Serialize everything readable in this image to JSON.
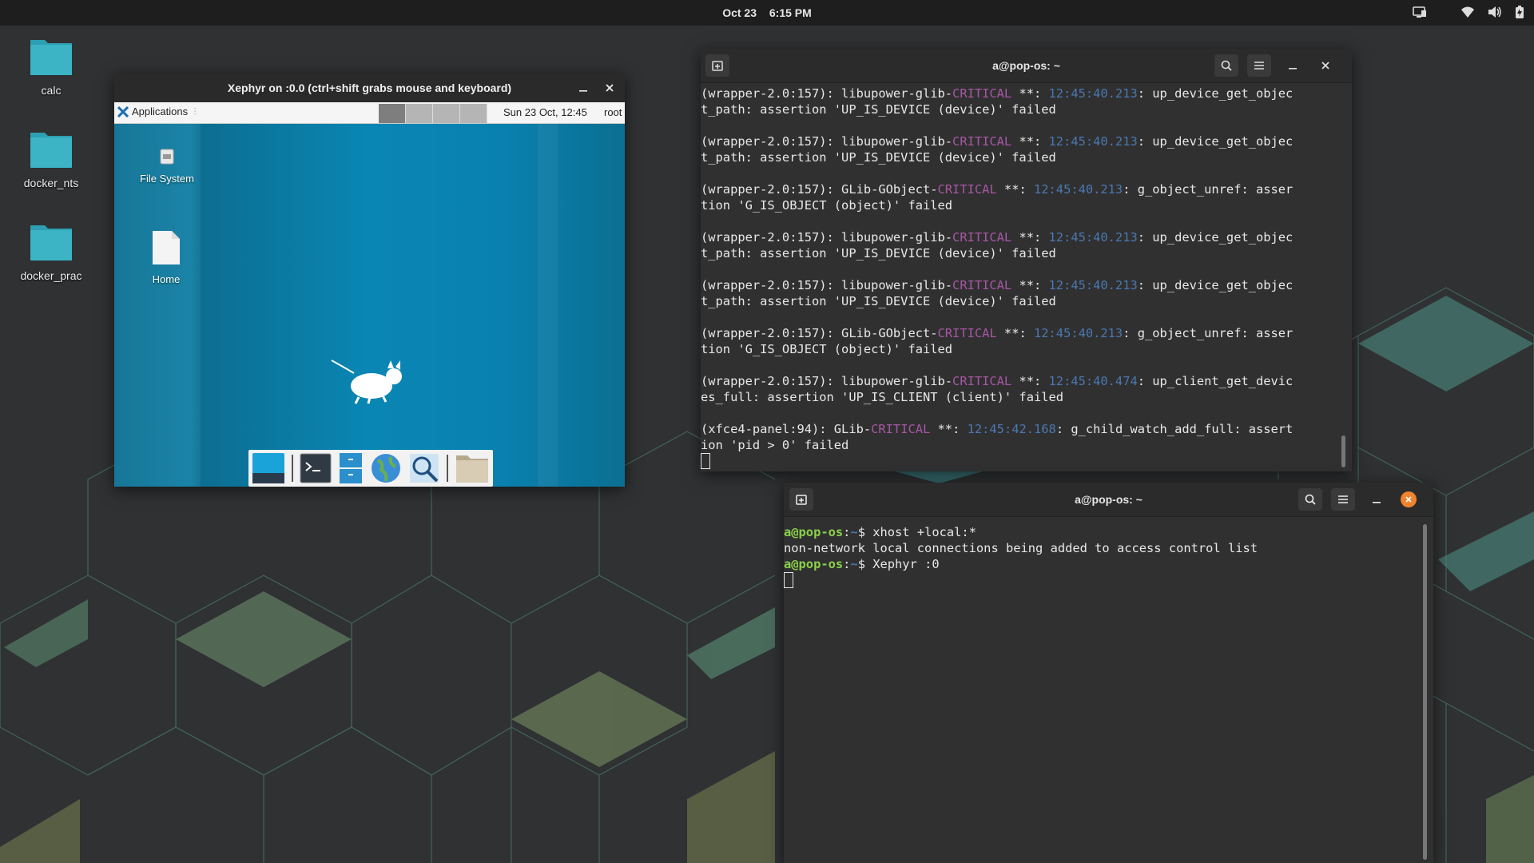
{
  "topbar": {
    "date": "Oct 23",
    "time": "6:15 PM",
    "tray_icons": [
      "display-icon",
      "wifi-icon",
      "volume-icon",
      "battery-icon"
    ]
  },
  "desktop_icons": [
    {
      "label": "calc",
      "icon": "folder-icon"
    },
    {
      "label": "docker_nts",
      "icon": "folder-icon"
    },
    {
      "label": "docker_prac",
      "icon": "folder-icon"
    }
  ],
  "xephyr": {
    "title": "Xephyr on :0.0 (ctrl+shift grabs mouse and keyboard)",
    "panel": {
      "applications": "Applications",
      "date": "Sun 23 Oct, 12:45",
      "user": "root"
    },
    "desktop_icons": [
      {
        "label": "File System",
        "icon": "drive-icon"
      },
      {
        "label": "Home",
        "icon": "home-file-icon"
      }
    ],
    "dock_items": [
      "show-desktop-icon",
      "terminal-icon",
      "file-manager-icon",
      "web-browser-icon",
      "app-finder-icon",
      "folder-icon"
    ]
  },
  "terminal1": {
    "title": "a@pop-os: ~",
    "lines": [
      [
        {
          "t": "(wrapper-2.0:157): libupower-glib-"
        },
        {
          "t": "CRITICAL",
          "c": "crit"
        },
        {
          "t": " **: "
        },
        {
          "t": "12:45:40.213",
          "c": "ts"
        },
        {
          "t": ": up_device_get_objec"
        }
      ],
      [
        {
          "t": "t_path: assertion 'UP_IS_DEVICE (device)' failed"
        }
      ],
      [
        {
          "t": ""
        }
      ],
      [
        {
          "t": "(wrapper-2.0:157): libupower-glib-"
        },
        {
          "t": "CRITICAL",
          "c": "crit"
        },
        {
          "t": " **: "
        },
        {
          "t": "12:45:40.213",
          "c": "ts"
        },
        {
          "t": ": up_device_get_objec"
        }
      ],
      [
        {
          "t": "t_path: assertion 'UP_IS_DEVICE (device)' failed"
        }
      ],
      [
        {
          "t": ""
        }
      ],
      [
        {
          "t": "(wrapper-2.0:157): GLib-GObject-"
        },
        {
          "t": "CRITICAL",
          "c": "crit"
        },
        {
          "t": " **: "
        },
        {
          "t": "12:45:40.213",
          "c": "ts"
        },
        {
          "t": ": g_object_unref: asser"
        }
      ],
      [
        {
          "t": "tion 'G_IS_OBJECT (object)' failed"
        }
      ],
      [
        {
          "t": ""
        }
      ],
      [
        {
          "t": "(wrapper-2.0:157): libupower-glib-"
        },
        {
          "t": "CRITICAL",
          "c": "crit"
        },
        {
          "t": " **: "
        },
        {
          "t": "12:45:40.213",
          "c": "ts"
        },
        {
          "t": ": up_device_get_objec"
        }
      ],
      [
        {
          "t": "t_path: assertion 'UP_IS_DEVICE (device)' failed"
        }
      ],
      [
        {
          "t": ""
        }
      ],
      [
        {
          "t": "(wrapper-2.0:157): libupower-glib-"
        },
        {
          "t": "CRITICAL",
          "c": "crit"
        },
        {
          "t": " **: "
        },
        {
          "t": "12:45:40.213",
          "c": "ts"
        },
        {
          "t": ": up_device_get_objec"
        }
      ],
      [
        {
          "t": "t_path: assertion 'UP_IS_DEVICE (device)' failed"
        }
      ],
      [
        {
          "t": ""
        }
      ],
      [
        {
          "t": "(wrapper-2.0:157): GLib-GObject-"
        },
        {
          "t": "CRITICAL",
          "c": "crit"
        },
        {
          "t": " **: "
        },
        {
          "t": "12:45:40.213",
          "c": "ts"
        },
        {
          "t": ": g_object_unref: asser"
        }
      ],
      [
        {
          "t": "tion 'G_IS_OBJECT (object)' failed"
        }
      ],
      [
        {
          "t": ""
        }
      ],
      [
        {
          "t": "(wrapper-2.0:157): libupower-glib-"
        },
        {
          "t": "CRITICAL",
          "c": "crit"
        },
        {
          "t": " **: "
        },
        {
          "t": "12:45:40.474",
          "c": "ts"
        },
        {
          "t": ": up_client_get_devic"
        }
      ],
      [
        {
          "t": "es_full: assertion 'UP_IS_CLIENT (client)' failed"
        }
      ],
      [
        {
          "t": ""
        }
      ],
      [
        {
          "t": "(xfce4-panel:94): GLib-"
        },
        {
          "t": "CRITICAL",
          "c": "crit"
        },
        {
          "t": " **: "
        },
        {
          "t": "12:45:42.168",
          "c": "ts"
        },
        {
          "t": ": g_child_watch_add_full: assert"
        }
      ],
      [
        {
          "t": "ion 'pid > 0' failed"
        }
      ]
    ]
  },
  "terminal2": {
    "title": "a@pop-os: ~",
    "lines": [
      [
        {
          "t": "a@pop-os",
          "c": "prompt-user"
        },
        {
          "t": ":"
        },
        {
          "t": "~",
          "c": "prompt-path"
        },
        {
          "t": "$ xhost +local:*"
        }
      ],
      [
        {
          "t": "non-network local connections being added to access control list"
        }
      ],
      [
        {
          "t": "a@pop-os",
          "c": "prompt-user"
        },
        {
          "t": ":"
        },
        {
          "t": "~",
          "c": "prompt-path"
        },
        {
          "t": "$ Xephyr :0"
        }
      ]
    ]
  },
  "colors": {
    "accent_orange": "#f0832e",
    "critical_purple": "#a657a4",
    "timestamp_blue": "#4b78b0",
    "prompt_green": "#8bd14b",
    "folder_teal": "#3cb4c6"
  }
}
